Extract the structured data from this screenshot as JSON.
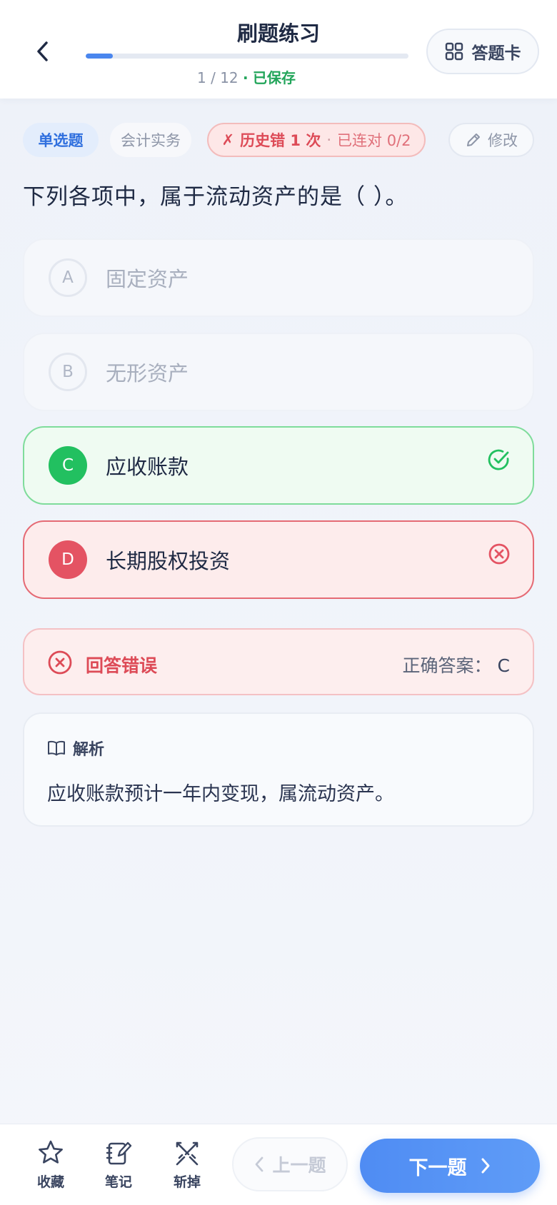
{
  "header": {
    "title": "刷题练习",
    "progress_text": "1 / 12",
    "progress_separator": "·",
    "saved_text": "已保存",
    "progress_fraction": 0.0833,
    "card_button_label": "答题卡"
  },
  "tags": {
    "type": "单选题",
    "subject": "会计实务",
    "history_mark": "✗",
    "history_wrong": "历史错 1 次",
    "history_dot": "·",
    "history_streak": "已连对 0/2",
    "edit_label": "修改"
  },
  "question": {
    "text": "下列各项中，属于流动资产的是（ ）。"
  },
  "options": [
    {
      "letter": "A",
      "text": "固定资产",
      "state": "neutral"
    },
    {
      "letter": "B",
      "text": "无形资产",
      "state": "neutral"
    },
    {
      "letter": "C",
      "text": "应收账款",
      "state": "correct"
    },
    {
      "letter": "D",
      "text": "长期股权投资",
      "state": "wrong"
    }
  ],
  "result": {
    "label": "回答错误",
    "answer_label": "正确答案：",
    "answer_value": "C"
  },
  "analysis": {
    "title": "解析",
    "body": "应收账款预计一年内变现，属流动资产。"
  },
  "bottom": {
    "favorite_label": "收藏",
    "note_label": "笔记",
    "cut_label": "斩掉",
    "prev_label": "上一题",
    "next_label": "下一题"
  },
  "colors": {
    "primary": "#4a86ee",
    "success": "#22c060",
    "danger": "#e45363"
  },
  "icons": [
    "back-arrow-icon",
    "grid-icon",
    "pencil-icon",
    "check-circle-icon",
    "x-circle-icon",
    "book-icon",
    "star-icon",
    "note-icon",
    "swords-icon",
    "chevron-left-icon",
    "chevron-right-icon"
  ]
}
